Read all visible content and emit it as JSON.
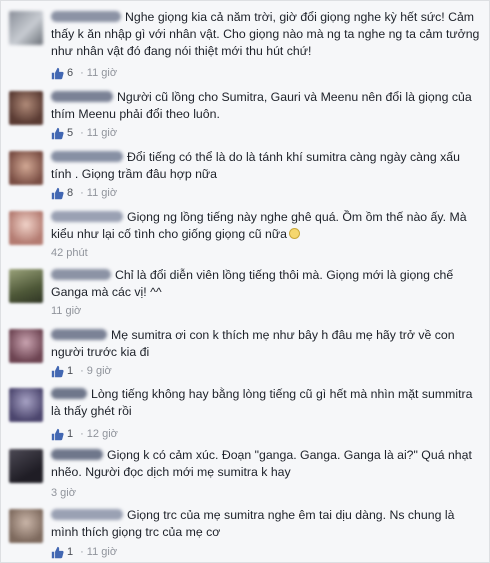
{
  "comments": [
    {
      "text": "Nghe giọng kia cả năm trời, giờ đổi giọng nghe kỳ hết sức! Cảm thấy k ăn nhập gì với nhân vật. Cho giọng nào mà ng ta nghe ng ta cảm tưởng như nhân vật đó đang nói thiệt mới thu hút chứ!",
      "likes": "6",
      "time": "11 giờ"
    },
    {
      "text": "Người cũ lồng cho Sumitra, Gauri và Meenu nên đổi là giọng của thím Meenu phải đổi theo luôn.",
      "likes": "5",
      "time": "11 giờ"
    },
    {
      "text": "Đổi tiếng có thể là do là tánh khí sumitra càng ngày càng xấu tính . Giọng trầm đâu hợp nữa",
      "likes": "8",
      "time": "11 giờ"
    },
    {
      "text": "Giọng ng lồng tiếng này nghe ghê quá. Ồm ồm thế nào ấy. Mà kiểu như lại cố tình cho giống giọng cũ nữa",
      "likes": "",
      "time": "42 phút"
    },
    {
      "text": "Chỉ là đổi diễn viên lồng tiếng thôi mà. Giọng mới là giọng chế Ganga mà các vị! ^^",
      "likes": "",
      "time": "11 giờ"
    },
    {
      "text": "Mẹ sumitra ơi con k thích mẹ như bây h đâu mẹ hãy trở về con người trước kia đi",
      "likes": "1",
      "time": "9 giờ"
    },
    {
      "text": "Lòng tiếng không hay bằng lòng tiếng cũ gì hết mà nhìn mặt summitra là thấy ghét rồi",
      "likes": "1",
      "time": "12 giờ"
    },
    {
      "text": "Giọng k có cảm xúc. Đoạn \"ganga. Ganga. Ganga là ai?\" Quá nhạt nhẽo. Người đọc dịch mới mẹ sumitra k hay",
      "likes": "",
      "time": "3 giờ"
    },
    {
      "text": "Giọng trc của mẹ sumitra nghe êm tai dịu dàng. Ns chung là mình thích giọng trc của mẹ cơ",
      "likes": "1",
      "time": "11 giờ"
    }
  ],
  "colors": {
    "like_blue": "#4267b2",
    "meta_gray": "#90949c"
  }
}
